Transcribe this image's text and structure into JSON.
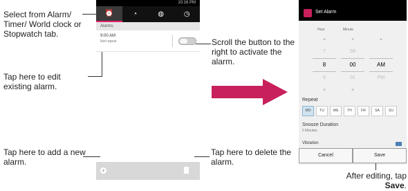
{
  "callouts": {
    "select_tab": "Select from Alarm/ Timer/ World clock or Stopwatch tab.",
    "scroll_button": "Scroll the button to the right to activate the alarm.",
    "edit_alarm": "Tap here to edit existing alarm.",
    "add_alarm": "Tap here to add a new alarm.",
    "delete_alarm": "Tap here to delete the alarm.",
    "after_editing": "After editing, tap",
    "after_editing_bold": "Save"
  },
  "phone1": {
    "status_text": "10:16 PM",
    "tabs": [
      "alarm-icon",
      "timer-icon",
      "world-clock-icon",
      "stopwatch-icon"
    ],
    "section_label": "Alarms",
    "alarm": {
      "time": "9:00 AM",
      "repeat": "Not repeat"
    }
  },
  "phone2": {
    "title": "Set Alarm",
    "hour_label": "Hour",
    "minute_label": "Minute",
    "hour_values": [
      "7",
      "8",
      "9"
    ],
    "minute_values": [
      "59",
      "00",
      "01"
    ],
    "ampm_values": [
      "",
      "AM",
      "PM"
    ],
    "repeat_label": "Repeat",
    "days": [
      "MO",
      "TU",
      "WE",
      "TH",
      "FR",
      "SA",
      "SU"
    ],
    "selected_day": "MO",
    "snooze_label": "Snooze Duration",
    "snooze_value": "5 Minutes",
    "vibration_label": "Vibration",
    "cancel_label": "Cancel",
    "save_label": "Save"
  },
  "colors": {
    "accent": "#e2226a",
    "arrow": "#c8205c",
    "day_selected": "#cfe3ef"
  }
}
